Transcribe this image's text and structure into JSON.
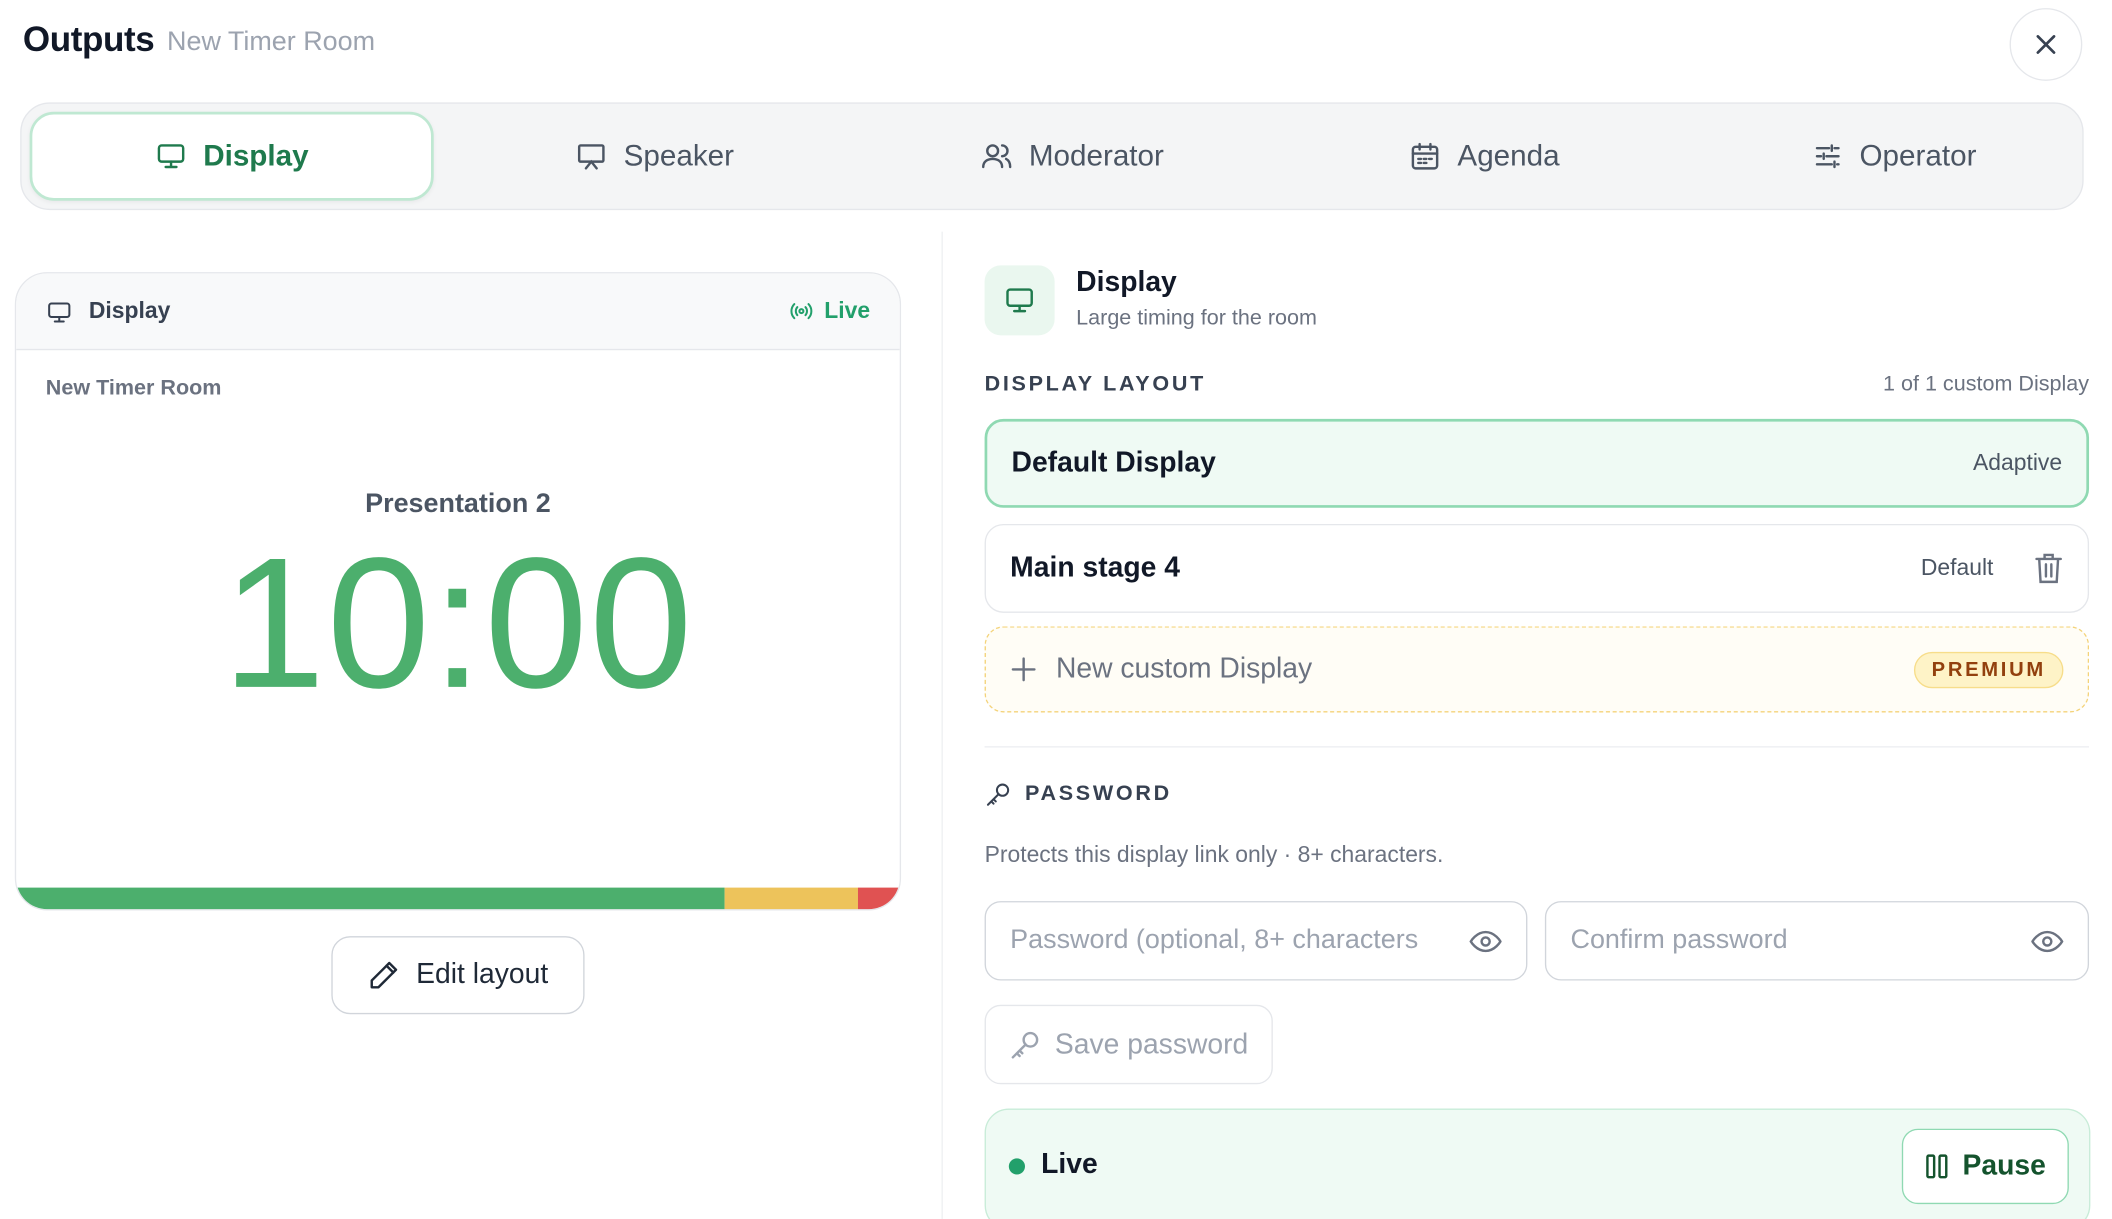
{
  "header": {
    "title": "Outputs",
    "subtitle": "New Timer Room"
  },
  "tabs": [
    {
      "label": "Display",
      "icon": "monitor-icon",
      "active": true
    },
    {
      "label": "Speaker",
      "icon": "presentation-icon",
      "active": false
    },
    {
      "label": "Moderator",
      "icon": "users-icon",
      "active": false
    },
    {
      "label": "Agenda",
      "icon": "calendar-icon",
      "active": false
    },
    {
      "label": "Operator",
      "icon": "sliders-icon",
      "active": false
    }
  ],
  "preview": {
    "header_title": "Display",
    "live_label": "Live",
    "room_name": "New Timer Room",
    "presentation": "Presentation 2",
    "time": "10:00",
    "progress_segments": [
      {
        "fraction": 0.8,
        "color": "#4caf6d"
      },
      {
        "fraction": 0.15,
        "color": "#edc35b"
      },
      {
        "fraction": 0.05,
        "color": "#e05252"
      }
    ]
  },
  "edit_layout_label": "Edit layout",
  "panel": {
    "title": "Display",
    "subtitle": "Large timing for the room",
    "layout_label": "DISPLAY LAYOUT",
    "layout_count": "1 of 1 custom Display",
    "layouts": [
      {
        "name": "Default Display",
        "tag": "Adaptive"
      },
      {
        "name": "Main stage 4",
        "tag": "Default"
      }
    ],
    "new_label": "New custom Display",
    "premium_label": "PREMIUM"
  },
  "password": {
    "label": "PASSWORD",
    "help": "Protects this display link only · 8+ characters.",
    "password_placeholder": "Password (optional, 8+ characters",
    "confirm_placeholder": "Confirm password",
    "save_label": "Save password"
  },
  "live": {
    "status": "Live",
    "pause_label": "Pause"
  },
  "colors": {
    "accent": "#22a06b",
    "timer": "#4caf6d",
    "premium": "#92400e"
  }
}
